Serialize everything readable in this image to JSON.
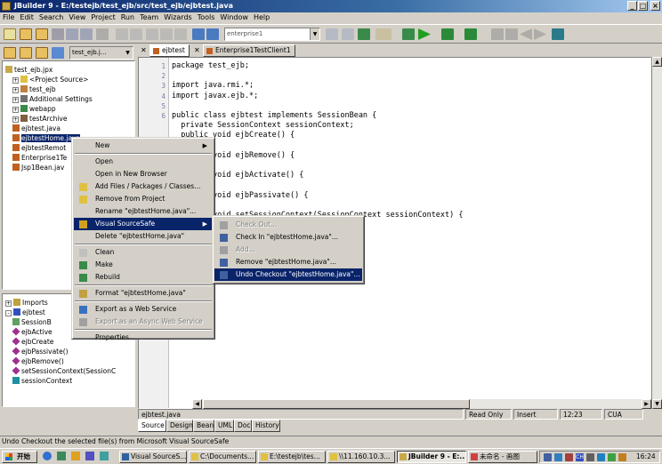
{
  "window": {
    "title": "JBuilder 9 - E:/testejb/test_ejb/src/test_ejb/ejbtest.java",
    "minimize": "_",
    "maximize": "□",
    "close": "×"
  },
  "menubar": [
    "File",
    "Edit",
    "Search",
    "View",
    "Project",
    "Run",
    "Team",
    "Wizards",
    "Tools",
    "Window",
    "Help"
  ],
  "toolbar": {
    "combo_value": "enterprise1"
  },
  "project_panel": {
    "combo_value": "test_ejb.j...",
    "tree": [
      {
        "label": "test_ejb.jpx",
        "icon": "project-icon",
        "indent": 0,
        "toggle": ""
      },
      {
        "label": "<Project Source>",
        "icon": "folder-icon",
        "indent": 1,
        "toggle": "+"
      },
      {
        "label": "test_ejb",
        "icon": "package-icon",
        "indent": 1,
        "toggle": "+"
      },
      {
        "label": "Additional Settings",
        "icon": "settings-icon",
        "indent": 1,
        "toggle": "+"
      },
      {
        "label": "webapp",
        "icon": "webapp-icon",
        "indent": 1,
        "toggle": "+"
      },
      {
        "label": "testArchive",
        "icon": "archive-icon",
        "indent": 1,
        "toggle": "+"
      },
      {
        "label": "ejbtest.java",
        "icon": "java-file-icon",
        "indent": 1,
        "toggle": ""
      },
      {
        "label": "ejbtestHome.java",
        "icon": "java-file-icon",
        "indent": 1,
        "toggle": "",
        "selected": true
      },
      {
        "label": "ejbtestRemot",
        "icon": "java-file-icon",
        "indent": 1,
        "toggle": ""
      },
      {
        "label": "Enterprise1Te",
        "icon": "java-file-icon",
        "indent": 1,
        "toggle": ""
      },
      {
        "label": "Jsp1Bean.jav",
        "icon": "java-file-icon",
        "indent": 1,
        "toggle": ""
      }
    ]
  },
  "structure_panel": {
    "tree": [
      {
        "label": "Imports",
        "icon": "imports-icon",
        "indent": 0,
        "toggle": "+"
      },
      {
        "label": "ejbtest",
        "icon": "class-icon",
        "indent": 0,
        "toggle": "-"
      },
      {
        "label": "SessionB",
        "icon": "interface-icon",
        "indent": 1,
        "toggle": ""
      },
      {
        "label": "ejbActive",
        "icon": "method-icon",
        "indent": 1,
        "toggle": ""
      },
      {
        "label": "ejbCreate",
        "icon": "method-icon",
        "indent": 1,
        "toggle": ""
      },
      {
        "label": "ejbPassivate()",
        "icon": "method-icon",
        "indent": 1,
        "toggle": ""
      },
      {
        "label": "ejbRemove()",
        "icon": "method-icon",
        "indent": 1,
        "toggle": ""
      },
      {
        "label": "setSessionContext(SessionC",
        "icon": "method-icon",
        "indent": 1,
        "toggle": ""
      },
      {
        "label": "sessionContext",
        "icon": "field-icon",
        "indent": 1,
        "toggle": ""
      }
    ]
  },
  "editor": {
    "tabs": [
      "ejbtest",
      "Enterprise1TestClient1"
    ],
    "lines": [
      {
        "n": "1",
        "text": "package test_ejb;"
      },
      {
        "n": "2",
        "text": ""
      },
      {
        "n": "3",
        "text": "import java.rmi.*;"
      },
      {
        "n": "4",
        "text": "import javax.ejb.*;"
      },
      {
        "n": "5",
        "text": ""
      },
      {
        "n": "6",
        "text": "public class ejbtest implements SessionBean {"
      },
      {
        "n": "",
        "text": "  private SessionContext sessionContext;"
      },
      {
        "n": "",
        "text": "  public void ejbCreate() {"
      },
      {
        "n": "",
        "text": ""
      },
      {
        "n": "",
        "text": "  public void ejbRemove() {"
      },
      {
        "n": "",
        "text": ""
      },
      {
        "n": "",
        "text": "  public void ejbActivate() {"
      },
      {
        "n": "",
        "text": ""
      },
      {
        "n": "",
        "text": "  public void ejbPassivate() {"
      },
      {
        "n": "",
        "text": ""
      },
      {
        "n": "",
        "text": "  public void setSessionContext(SessionContext sessionContext) {"
      }
    ],
    "filename": "ejbtest.java",
    "status": {
      "mode": "Read Only",
      "insert": "Insert",
      "position": "12:23",
      "encoding": "CUA"
    },
    "bottom_tabs": [
      "Source",
      "Design",
      "Bean",
      "UML",
      "Doc",
      "History"
    ]
  },
  "context_menu": [
    {
      "label": "New",
      "icon": "",
      "submenu": true
    },
    {
      "sep": true
    },
    {
      "label": "Open",
      "icon": ""
    },
    {
      "label": "Open in New Browser",
      "icon": ""
    },
    {
      "label": "Add Files / Packages / Classes...",
      "icon": "add-files-icon"
    },
    {
      "label": "Remove from Project",
      "icon": "remove-icon"
    },
    {
      "label": "Rename \"ejbtestHome.java\"...",
      "icon": ""
    },
    {
      "label": "Visual SourceSafe",
      "icon": "vss-icon",
      "submenu": true,
      "highlight": true
    },
    {
      "label": "Delete \"ejbtestHome.java\"",
      "icon": ""
    },
    {
      "sep": true
    },
    {
      "label": "Clean",
      "icon": "clean-icon"
    },
    {
      "label": "Make",
      "icon": "make-icon"
    },
    {
      "label": "Rebuild",
      "icon": "rebuild-icon"
    },
    {
      "sep": true
    },
    {
      "label": "Format \"ejbtestHome.java\"",
      "icon": "format-icon"
    },
    {
      "sep": true
    },
    {
      "label": "Export as a Web Service",
      "icon": "export-ws-icon"
    },
    {
      "label": "Export as an Async Web Service",
      "icon": "export-async-icon",
      "disabled": true
    },
    {
      "sep": true
    },
    {
      "label": "Properties...",
      "icon": ""
    }
  ],
  "submenu": [
    {
      "label": "Check Out...",
      "icon": "checkout-icon",
      "disabled": true
    },
    {
      "label": "Check In \"ejbtestHome.java\"...",
      "icon": "checkin-icon"
    },
    {
      "label": "Add...",
      "icon": "add-icon",
      "disabled": true
    },
    {
      "label": "Remove \"ejbtestHome.java\"...",
      "icon": "remove-vss-icon"
    },
    {
      "label": "Undo Checkout \"ejbtestHome.java\"...",
      "icon": "undo-checkout-icon",
      "highlight": true
    }
  ],
  "statusbar": "Undo Checkout the selected file(s) from Microsoft Visual SourceSafe",
  "taskbar": {
    "start": "开始",
    "buttons": [
      "Visual SourceS...",
      "C:\\Documents...",
      "E:\\testejb\\tes...",
      "\\\\11.160.10.3...",
      "JBuilder 9 - E:...",
      "未命名 - 画图"
    ],
    "clock": "16:24",
    "lang": "CH"
  }
}
